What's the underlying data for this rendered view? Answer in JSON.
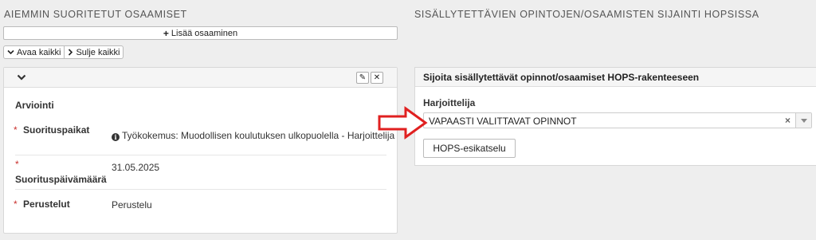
{
  "left": {
    "title": "AIEMMIN SUORITETUT OSAAMISET",
    "add_label": "Lisää osaaminen",
    "open_all": "Avaa kaikki",
    "close_all": "Sulje kaikki",
    "section_title": "Arviointi",
    "fields": [
      {
        "label": "Suorituspaikat",
        "value": "Työkokemus: Muodollisen koulutuksen ulkopuolella - Harjoittelija"
      },
      {
        "label": "Suorituspäivämäärä",
        "value": "31.05.2025"
      },
      {
        "label": "Perustelut",
        "value": "Perustelu"
      }
    ],
    "required_marker": "*",
    "info_glyph": "i"
  },
  "right": {
    "title": "SISÄLLYTETTÄVIEN OPINTOJEN/OSAAMISTEN SIJAINTI HOPSISSA",
    "panel_title": "Sijoita sisällytettävät opinnot/osaamiset HOPS-rakenteeseen",
    "group_label": "Harjoittelija",
    "selected_value": "VAPAASTI VALITTAVAT OPINNOT",
    "clear_glyph": "×",
    "preview_button": "HOPS-esikatselu"
  },
  "icons": {
    "plus": "+",
    "chevron": "⌄",
    "chevron_right": "›",
    "edit": "✎",
    "close": "✕"
  },
  "colors": {
    "background": "#eeeeee",
    "required": "#c9302c",
    "annotation_arrow": "#e02020"
  }
}
